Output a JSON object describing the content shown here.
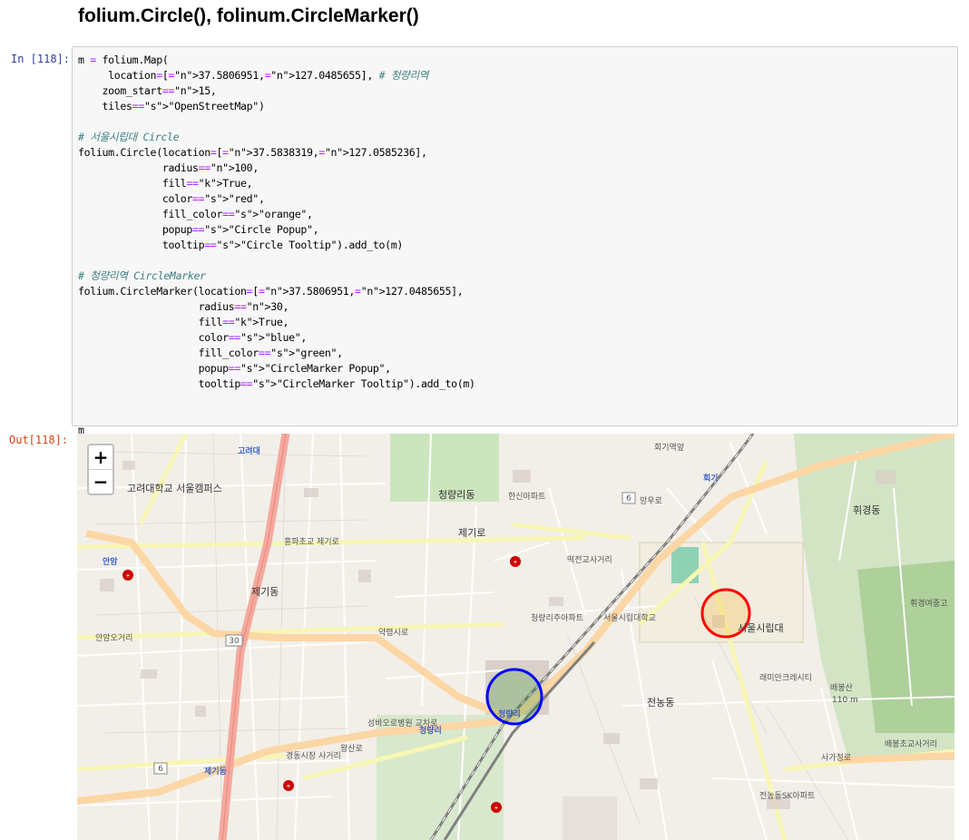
{
  "heading": "folium.Circle(), folinum.CircleMarker()",
  "cell": {
    "in_prompt": "In [118]:",
    "out_prompt": "Out[118]:"
  },
  "code_lines": [
    "m = folium.Map(",
    "     location=[37.5806951,127.0485655], # 청량리역",
    "    zoom_start=15,",
    "    tiles=\"OpenStreetMap\")",
    "",
    "# 서울시립대 Circle",
    "folium.Circle(location=[37.5838319,127.0585236],",
    "              radius=100,",
    "              fill=True,",
    "              color=\"red\",",
    "              fill_color=\"orange\",",
    "              popup=\"Circle Popup\",",
    "              tooltip=\"Circle Tooltip\").add_to(m)",
    "",
    "# 청량리역 CircleMarker",
    "folium.CircleMarker(location=[37.5806951,127.0485655],",
    "                    radius=30,",
    "                    fill=True,",
    "                    color=\"blue\",",
    "                    fill_color=\"green\",",
    "                    popup=\"CircleMarker Popup\",",
    "                    tooltip=\"CircleMarker Tooltip\").add_to(m)",
    "",
    "",
    "m"
  ],
  "map": {
    "zoom_in": "+",
    "zoom_out": "−",
    "circle_color": "#ff0000",
    "circle_fill": "#ffa500",
    "marker_color": "#0000ff",
    "marker_fill": "#008000",
    "labels": {
      "goryeodae": "고려대",
      "anam": "안암",
      "goryeo_univ": "고려대학교 서울캠퍼스",
      "cheongnyangni_dong": "청량리동",
      "hansin_apt": "한신아파트",
      "jegi_ro": "제기로",
      "jegi_dong": "제기동",
      "hongpa": "홍파초교 제기로",
      "yakryeong": "약령시로",
      "wangsan_ro": "왕산로",
      "cheongnyangni": "청량리",
      "cheongnyangni_station": "청량리",
      "uos_label": "서울시립대",
      "uos_station": "서울시립대학교",
      "hoegi": "회기",
      "hoegi_station": "회기역앞",
      "mangu_ro": "망우로",
      "hwigyeong": "휘경동",
      "jeonnong": "전농동",
      "baebongsan": "배봉산",
      "baebongsan_alt": "110 m",
      "sagajeong": "사가정로",
      "jeonnong_sk": "전농동SK아파트",
      "gyeongdong": "경동시장 사거리",
      "jegi_station": "제기동",
      "seongbaewo": "성바오로병원 교차로",
      "road_6": "6",
      "road_30": "30",
      "ttokjeon": "떡전교사거리",
      "anam_ogeori": "안암오거리",
      "baebong_school": "배봉초교사거리",
      "hwigyeong_school": "휘경여중고",
      "raemian": "래미안크레시티",
      "cheongnyangni_apt": "청량리주아파트"
    }
  }
}
